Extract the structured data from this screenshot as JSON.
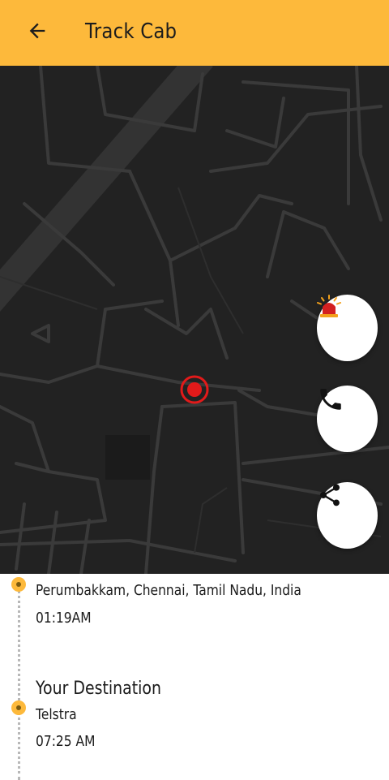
{
  "header": {
    "title": "Track Cab",
    "back_icon": "arrow-left-icon",
    "background": "#fdb93b"
  },
  "map": {
    "theme": "dark",
    "current_location_marker": "location-pin-icon",
    "marker_color": "#e21a1a"
  },
  "actions": [
    {
      "name": "sos-alarm-button",
      "icon": "siren-icon",
      "color": "#d32020"
    },
    {
      "name": "call-button",
      "icon": "phone-icon",
      "color": "#111111"
    },
    {
      "name": "share-button",
      "icon": "share-icon",
      "color": "#111111"
    }
  ],
  "trip": {
    "pickup": {
      "address": "Perumbakkam, Chennai, Tamil Nadu, India",
      "time": "01:19AM"
    },
    "destination": {
      "heading": "Your Destination",
      "name": "Telstra",
      "time": "07:25 AM"
    }
  }
}
